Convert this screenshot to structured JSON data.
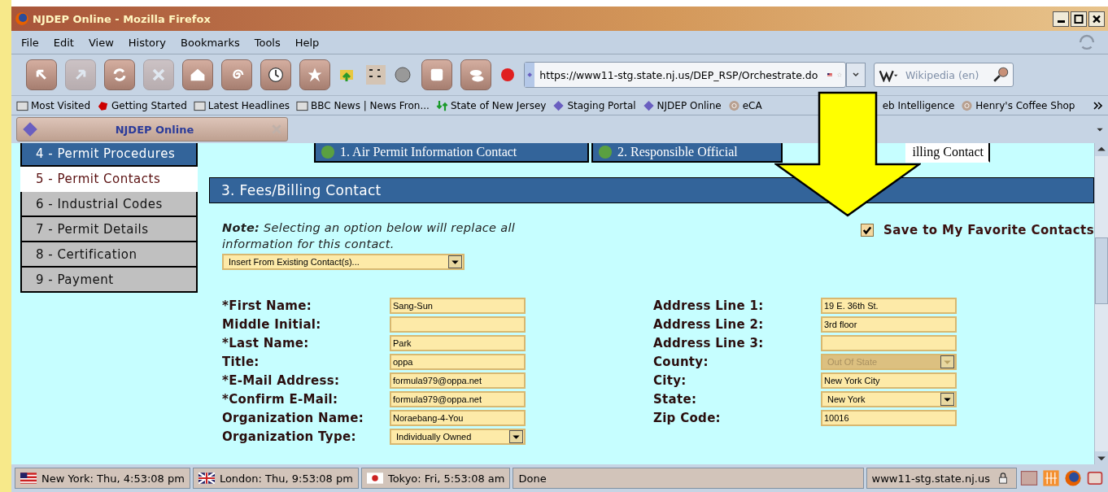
{
  "window": {
    "title": "NJDEP Online - Mozilla Firefox"
  },
  "menu": [
    {
      "label": "File"
    },
    {
      "label": "Edit"
    },
    {
      "label": "View"
    },
    {
      "label": "History"
    },
    {
      "label": "Bookmarks"
    },
    {
      "label": "Tools"
    },
    {
      "label": "Help"
    }
  ],
  "toolbar": {
    "url": "https://www11-stg.state.nj.us/DEP_RSP/Orchestrate.do",
    "search_placeholder": "Wikipedia (en)"
  },
  "bookmarks": [
    {
      "label": "Most Visited",
      "kind": "folder"
    },
    {
      "label": "Getting Started",
      "kind": "red"
    },
    {
      "label": "Latest Headlines",
      "kind": "feed"
    },
    {
      "label": "BBC News | News Fron...",
      "kind": "feed"
    },
    {
      "label": "State of New Jersey",
      "kind": "nj"
    },
    {
      "label": "Staging Portal",
      "kind": "diamond"
    },
    {
      "label": "NJDEP Online",
      "kind": "diamond"
    },
    {
      "label": "eCA",
      "kind": "spiral"
    },
    {
      "label": "eb Intelligence",
      "kind": "hidden"
    },
    {
      "label": "Henry's Coffee Shop",
      "kind": "spiral"
    }
  ],
  "browser_tab": {
    "label": "NJDEP Online"
  },
  "sidebar": {
    "items": [
      {
        "label": "4 - Permit Procedures",
        "completed": true,
        "selected": false
      },
      {
        "label": "5 - Permit Contacts",
        "completed": false,
        "selected": true
      },
      {
        "label": "6 - Industrial Codes",
        "completed": false,
        "selected": false
      },
      {
        "label": "7 - Permit Details",
        "completed": false,
        "selected": false
      },
      {
        "label": "8 - Certification",
        "completed": false,
        "selected": false
      },
      {
        "label": "9 - Payment",
        "completed": false,
        "selected": false
      }
    ]
  },
  "form_tabs": [
    {
      "label": "1. Air Permit Information Contact",
      "selected": false
    },
    {
      "label": "2. Responsible Official",
      "selected": false
    },
    {
      "label": "illing Contact",
      "selected": true
    }
  ],
  "section_title": "3. Fees/Billing Contact",
  "note": "**Note:** Selecting an option below will replace all information for this contact.",
  "insert_dropdown": {
    "value": "Insert From Existing Contact(s)..."
  },
  "favorite": {
    "label": "Save to My Favorite Contacts",
    "checked": true
  },
  "fields_left": [
    {
      "label": "*First Name:",
      "value": "Sang-Sun",
      "kind": "text"
    },
    {
      "label": "Middle Initial:",
      "kind": "text"
    },
    {
      "label": "*Last Name:",
      "value": "Park",
      "kind": "text"
    },
    {
      "label": "Title:",
      "value": "oppa",
      "kind": "text"
    },
    {
      "label": "*E-Mail Address:",
      "value": "formula979@oppa.net",
      "kind": "text"
    },
    {
      "label": "*Confirm E-Mail:",
      "value": "formula979@oppa.net",
      "kind": "text"
    },
    {
      "label": "Organization Name:",
      "value": "Noraebang-4-You",
      "kind": "text"
    },
    {
      "label": "Organization Type:",
      "value": "Individually Owned",
      "kind": "select"
    }
  ],
  "fields_right": [
    {
      "label": "Address Line 1:",
      "value": "19 E. 36th St.",
      "kind": "text"
    },
    {
      "label": "Address Line 2:",
      "value": "3rd floor",
      "kind": "text"
    },
    {
      "label": "Address Line 3:",
      "kind": "text"
    },
    {
      "label": "County:",
      "value": "Out Of State",
      "kind": "select",
      "disabled": true
    },
    {
      "label": "City:",
      "value": "New York City",
      "kind": "text"
    },
    {
      "label": "State:",
      "value": "New York",
      "kind": "select"
    },
    {
      "label": "Zip Code:",
      "value": "10016",
      "kind": "text"
    }
  ],
  "status_bar": {
    "clocks": [
      {
        "label": "New York: Thu, 4:53:08 pm",
        "kind": "us"
      },
      {
        "label": "London: Thu, 9:53:08 pm",
        "kind": "uk"
      },
      {
        "label": "Tokyo: Fri, 5:53:08 am",
        "kind": "jp"
      }
    ],
    "status": "Done",
    "domain": "www11-stg.state.nj.us"
  }
}
